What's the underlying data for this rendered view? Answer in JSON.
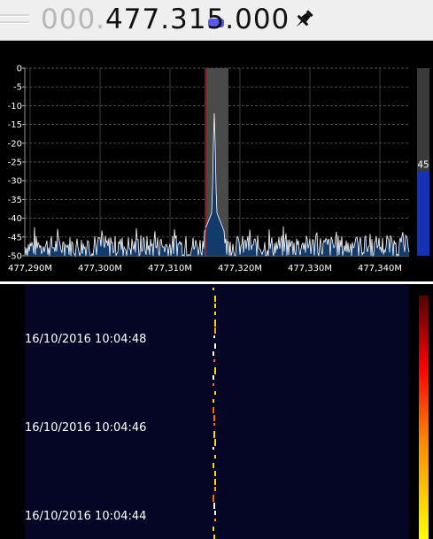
{
  "frequency": {
    "prefix": "000.",
    "main": "477.31",
    "highlight_digit": "5",
    "suffix": ".000"
  },
  "icons": {
    "handle": "grip-handle-icon",
    "pin": "pushpin-icon"
  },
  "colors": {
    "background": "#000000",
    "toolbar": "#efefef",
    "spectrum_fill": "#123a6b",
    "spectrum_line": "#ffffff",
    "filter_band": "#4a4a4a",
    "marker": "#ff2a2a",
    "waterfall_bg": "#050626",
    "snr_bar": "#1432b4",
    "gradient": [
      "#ffff00",
      "#ff8800",
      "#ff0000",
      "#550000"
    ]
  },
  "spectrum": {
    "db_labels": [
      "0",
      "-5",
      "-10",
      "-15",
      "-20",
      "-25",
      "-30",
      "-35",
      "-40",
      "-45",
      "-50"
    ],
    "freq_labels": [
      "477,290M",
      "477,300M",
      "477,310M",
      "477,320M",
      "477,330M",
      "477,340M"
    ],
    "snr_value": "45",
    "snr_level": 0.45
  },
  "waterfall": {
    "timestamps": [
      "16/10/2016 10:04:48",
      "16/10/2016 10:04:46",
      "16/10/2016 10:04:44"
    ]
  }
}
